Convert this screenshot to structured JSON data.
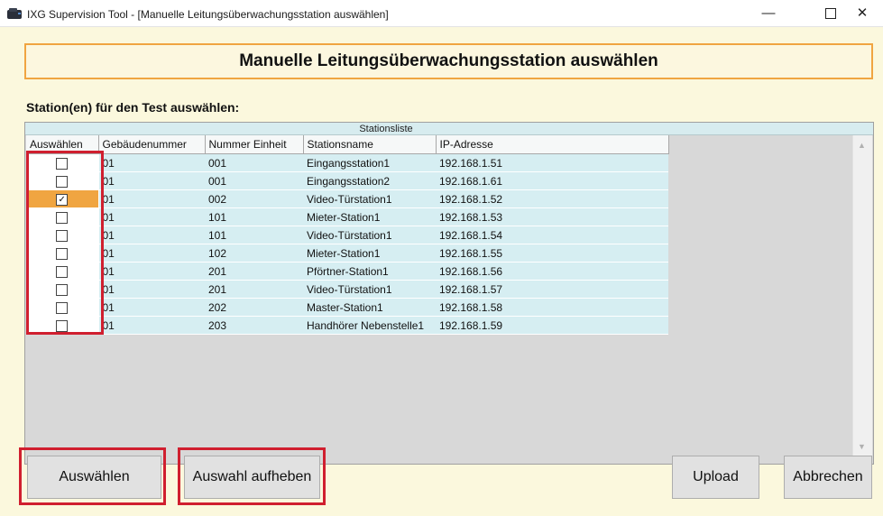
{
  "window": {
    "title": "IXG Supervision Tool - [Manuelle Leitungsüberwachungsstation auswählen]",
    "controls": {
      "minimize": "—",
      "close": "✕"
    }
  },
  "header": {
    "title": "Manuelle Leitungsüberwachungsstation auswählen"
  },
  "section_label": "Station(en) für den Test auswählen:",
  "grid": {
    "caption": "Stationsliste",
    "columns": [
      "Auswählen",
      "Gebäudenummer",
      "Nummer Einheit",
      "Stationsname",
      "IP-Adresse"
    ],
    "rows": [
      {
        "checked": false,
        "building": "01",
        "unit": "001",
        "name": "Eingangsstation1",
        "ip": "192.168.1.51"
      },
      {
        "checked": false,
        "building": "01",
        "unit": "001",
        "name": "Eingangsstation2",
        "ip": "192.168.1.61"
      },
      {
        "checked": true,
        "building": "01",
        "unit": "002",
        "name": "Video-Türstation1",
        "ip": "192.168.1.52"
      },
      {
        "checked": false,
        "building": "01",
        "unit": "101",
        "name": "Mieter-Station1",
        "ip": "192.168.1.53"
      },
      {
        "checked": false,
        "building": "01",
        "unit": "101",
        "name": "Video-Türstation1",
        "ip": "192.168.1.54"
      },
      {
        "checked": false,
        "building": "01",
        "unit": "102",
        "name": "Mieter-Station1",
        "ip": "192.168.1.55"
      },
      {
        "checked": false,
        "building": "01",
        "unit": "201",
        "name": "Pförtner-Station1",
        "ip": "192.168.1.56"
      },
      {
        "checked": false,
        "building": "01",
        "unit": "201",
        "name": "Video-Türstation1",
        "ip": "192.168.1.57"
      },
      {
        "checked": false,
        "building": "01",
        "unit": "202",
        "name": "Master-Station1",
        "ip": "192.168.1.58"
      },
      {
        "checked": false,
        "building": "01",
        "unit": "203",
        "name": "Handhörer Nebenstelle1",
        "ip": "192.168.1.59"
      }
    ]
  },
  "buttons": {
    "select": "Auswählen",
    "deselect": "Auswahl aufheben",
    "upload": "Upload",
    "cancel": "Abbrechen"
  },
  "colors": {
    "accent": "#f0a541",
    "highlight": "#d01f2f",
    "row_bg": "#d6eef2",
    "client_bg": "#fbf8dd"
  }
}
